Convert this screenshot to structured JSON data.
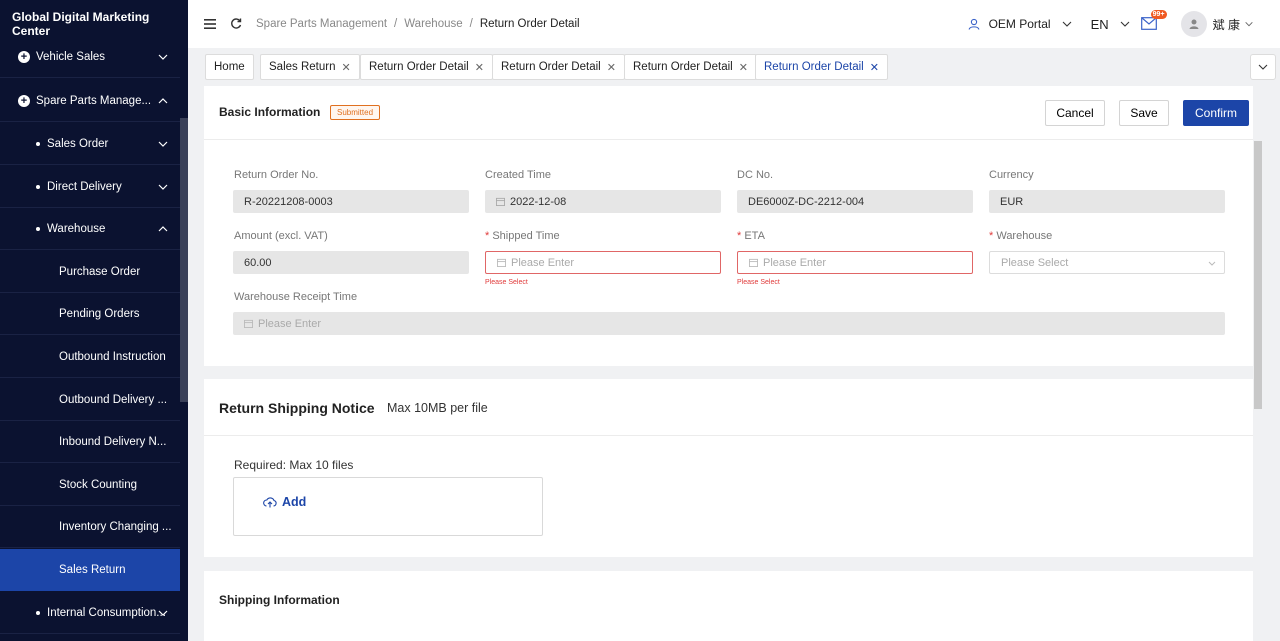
{
  "app": {
    "title": "Global Digital Marketing Center"
  },
  "sidebar": {
    "items": [
      {
        "label": "Vehicle Sales"
      },
      {
        "label": "Spare Parts Manage..."
      },
      {
        "label": "Sales Order"
      },
      {
        "label": "Direct Delivery"
      },
      {
        "label": "Warehouse"
      },
      {
        "label": "Purchase Order"
      },
      {
        "label": "Pending Orders"
      },
      {
        "label": "Outbound Instruction"
      },
      {
        "label": "Outbound Delivery ..."
      },
      {
        "label": "Inbound Delivery N..."
      },
      {
        "label": "Stock Counting"
      },
      {
        "label": "Inventory Changing ..."
      },
      {
        "label": "Sales Return"
      },
      {
        "label": "Internal Consumption..."
      }
    ]
  },
  "breadcrumb": {
    "l1": "Spare Parts Management",
    "l2": "Warehouse",
    "l3": "Return Order Detail",
    "sep": "/"
  },
  "header": {
    "portal": "OEM Portal",
    "lang": "EN",
    "badge": "99+",
    "user": "斌 康"
  },
  "tabs": [
    {
      "label": "Home"
    },
    {
      "label": "Sales Return"
    },
    {
      "label": "Return Order Detail"
    },
    {
      "label": "Return Order Detail"
    },
    {
      "label": "Return Order Detail"
    },
    {
      "label": "Return Order Detail"
    }
  ],
  "basic": {
    "title": "Basic Information",
    "status": "Submitted",
    "cancel": "Cancel",
    "save": "Save",
    "confirm": "Confirm",
    "fields": {
      "return_no": {
        "label": "Return Order No.",
        "value": "R-20221208-0003"
      },
      "created": {
        "label": "Created Time",
        "value": "2022-12-08"
      },
      "dc_no": {
        "label": "DC No.",
        "value": "DE6000Z-DC-2212-004"
      },
      "currency": {
        "label": "Currency",
        "value": "EUR"
      },
      "amount": {
        "label": "Amount (excl. VAT)",
        "value": "60.00"
      },
      "shipped": {
        "label": "Shipped Time",
        "placeholder": "Please Enter",
        "error": "Please Select"
      },
      "eta": {
        "label": "ETA",
        "placeholder": "Please Enter",
        "error": "Please Select"
      },
      "warehouse": {
        "label": "Warehouse",
        "placeholder": "Please Select"
      },
      "receipt": {
        "label": "Warehouse Receipt Time",
        "placeholder": "Please Enter"
      }
    },
    "req_mark": "*"
  },
  "notice": {
    "title": "Return Shipping Notice",
    "subtitle": "Max 10MB per file",
    "required": "Required:  Max 10 files",
    "add": "Add"
  },
  "shipping": {
    "title": "Shipping Information"
  }
}
